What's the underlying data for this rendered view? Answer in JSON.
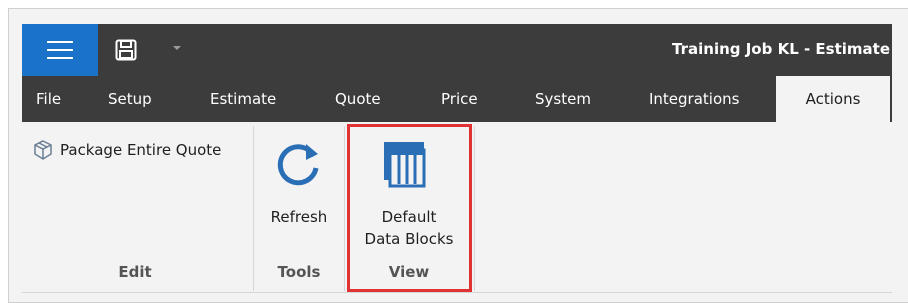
{
  "titlebar": {
    "window_title": "Training Job KL - Estimate"
  },
  "tabs": [
    {
      "label": "File"
    },
    {
      "label": "Setup"
    },
    {
      "label": "Estimate"
    },
    {
      "label": "Quote"
    },
    {
      "label": "Price"
    },
    {
      "label": "System"
    },
    {
      "label": "Integrations"
    },
    {
      "label": "Actions",
      "active": true
    }
  ],
  "ribbon": {
    "edit_group": {
      "label": "Edit",
      "package_button": "Package Entire Quote"
    },
    "tools_group": {
      "label": "Tools",
      "refresh_button": "Refresh"
    },
    "view_group": {
      "label": "View",
      "default_data_blocks_line1": "Default",
      "default_data_blocks_line2": "Data Blocks"
    }
  },
  "colors": {
    "titlebar_bg": "#3c3c3c",
    "menu_button_bg": "#1a73c9",
    "ribbon_bg": "#f3f3f3",
    "icon_blue": "#2a6fb5",
    "highlight": "#e03232"
  },
  "icons": {
    "menu": "hamburger-icon",
    "save": "save-icon",
    "qat": "chevron-down-icon",
    "package": "package-icon",
    "refresh": "refresh-icon",
    "data_blocks": "data-blocks-icon"
  }
}
